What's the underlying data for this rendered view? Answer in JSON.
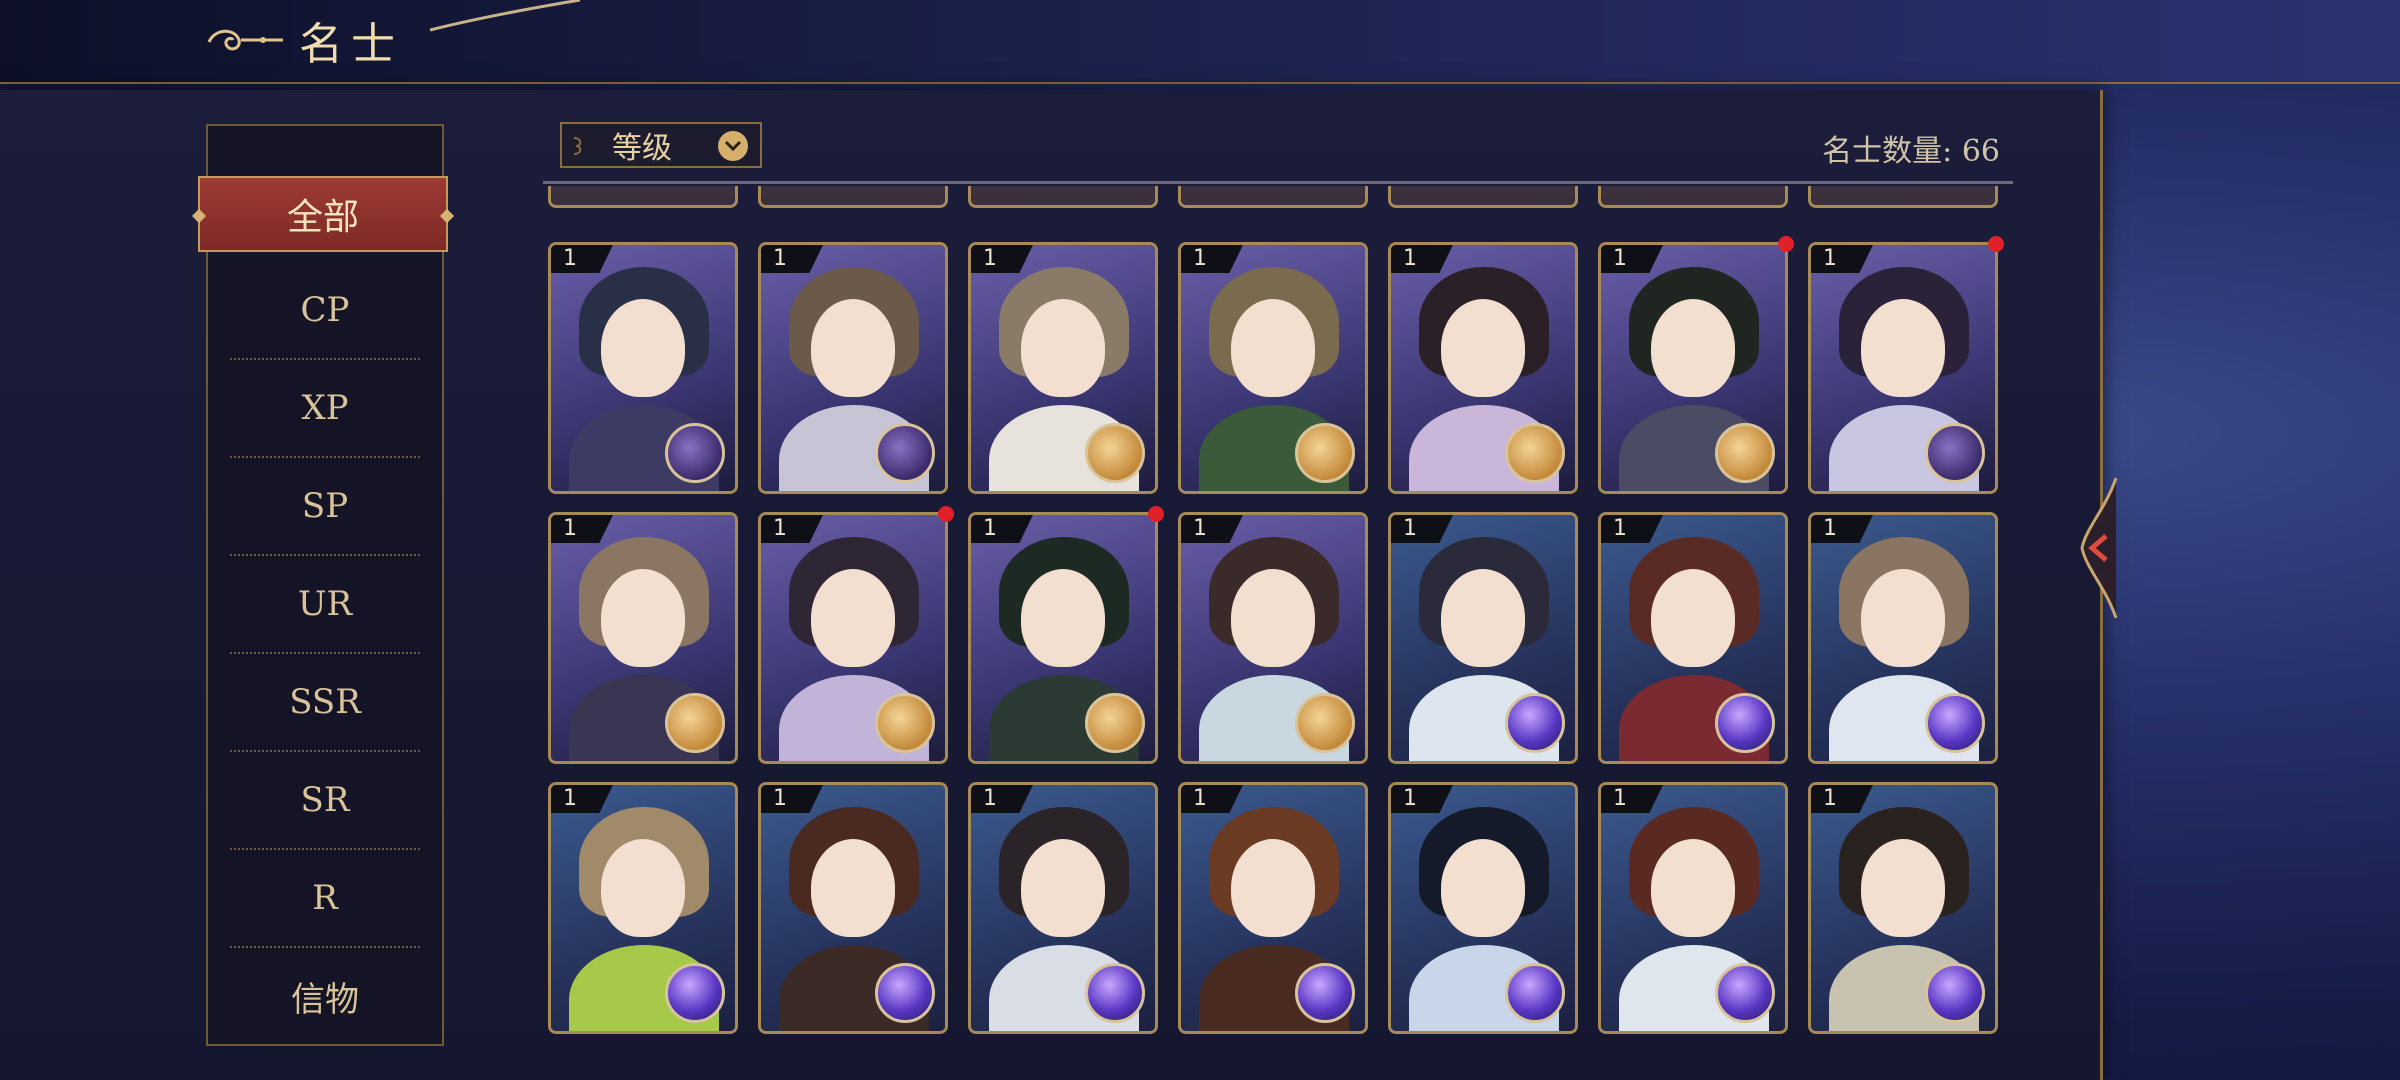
{
  "header": {
    "title": "名士"
  },
  "sidebar": {
    "active": "全部",
    "items": [
      "CP",
      "XP",
      "SP",
      "UR",
      "SSR",
      "SR",
      "R",
      "信物"
    ]
  },
  "toolbar": {
    "sort_label": "等级",
    "count_label": "名士数量: 66"
  },
  "cards": [
    {
      "level": "1",
      "hair": "#2a2f48",
      "body": "#3d3a63",
      "badge": "purple",
      "dot": false
    },
    {
      "level": "1",
      "hair": "#6b5a4a",
      "body": "#c7c4d6",
      "badge": "purple",
      "dot": false
    },
    {
      "level": "1",
      "hair": "#8a7a68",
      "body": "#e8e2dc",
      "badge": "gold",
      "dot": false
    },
    {
      "level": "1",
      "hair": "#7a6a4e",
      "body": "#3a5a3a",
      "badge": "gold",
      "dot": false
    },
    {
      "level": "1",
      "hair": "#2b1f28",
      "body": "#c9b6d8",
      "badge": "gold",
      "dot": false
    },
    {
      "level": "1",
      "hair": "#1f2520",
      "body": "#4b4b63",
      "badge": "gold",
      "dot": true
    },
    {
      "level": "1",
      "hair": "#2a2238",
      "body": "#c8c6e0",
      "badge": "purple",
      "dot": true
    },
    {
      "level": "1",
      "hair": "#8a7662",
      "body": "#3a3552",
      "badge": "gold",
      "dot": false
    },
    {
      "level": "1",
      "hair": "#2e2535",
      "body": "#c2b3d9",
      "badge": "gold",
      "dot": true
    },
    {
      "level": "1",
      "hair": "#1d2a23",
      "body": "#2c3a34",
      "badge": "gold",
      "dot": true
    },
    {
      "level": "1",
      "hair": "#3a2b2a",
      "body": "#c9d7e0",
      "badge": "gold",
      "dot": false
    },
    {
      "level": "1",
      "hair": "#2a2a3a",
      "body": "#dde6ee",
      "badge": "orb",
      "dot": false
    },
    {
      "level": "1",
      "hair": "#5a2b25",
      "body": "#7a2a30",
      "badge": "orb",
      "dot": false
    },
    {
      "level": "1",
      "hair": "#8a7462",
      "body": "#dfe6ef",
      "badge": "orb",
      "dot": false
    },
    {
      "level": "1",
      "hair": "#a08a6a",
      "body": "#a7c94a",
      "badge": "orb",
      "dot": false
    },
    {
      "level": "1",
      "hair": "#4a2a20",
      "body": "#3b2a26",
      "badge": "orb",
      "dot": false
    },
    {
      "level": "1",
      "hair": "#2a2428",
      "body": "#d8dde6",
      "badge": "orb",
      "dot": false
    },
    {
      "level": "1",
      "hair": "#6a3a22",
      "body": "#4a2b22",
      "badge": "orb",
      "dot": false
    },
    {
      "level": "1",
      "hair": "#151a2a",
      "body": "#c9d6ea",
      "badge": "orb",
      "dot": false
    },
    {
      "level": "1",
      "hair": "#5a2a22",
      "body": "#e0e6ee",
      "badge": "orb",
      "dot": false
    },
    {
      "level": "1",
      "hair": "#2a221e",
      "body": "#c8c3b0",
      "badge": "orb",
      "dot": false
    }
  ]
}
